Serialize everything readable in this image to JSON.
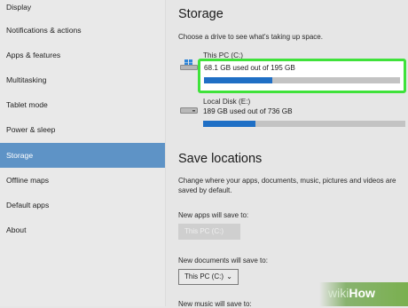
{
  "sidebar": {
    "items": [
      {
        "label": "Display"
      },
      {
        "label": "Notifications & actions"
      },
      {
        "label": "Apps & features"
      },
      {
        "label": "Multitasking"
      },
      {
        "label": "Tablet mode"
      },
      {
        "label": "Power & sleep"
      },
      {
        "label": "Storage"
      },
      {
        "label": "Offline maps"
      },
      {
        "label": "Default apps"
      },
      {
        "label": "About"
      }
    ],
    "active_item": "Storage"
  },
  "storage": {
    "title": "Storage",
    "subtitle": "Choose a drive to see what's taking up space.",
    "drives": [
      {
        "name": "This PC (C:)",
        "usage": "68.1 GB used out of 195 GB",
        "used_fraction": 0.35,
        "icon": "windows-drive-icon"
      },
      {
        "name": "Local Disk (E:)",
        "usage": "189 GB used out of 736 GB",
        "used_fraction": 0.257,
        "icon": "disk-drive-icon"
      }
    ]
  },
  "save_locations": {
    "title": "Save locations",
    "description": "Change where your apps, documents, music, pictures and videos are saved by default.",
    "new_apps_label": "New apps will save to:",
    "new_apps_value": "This PC (C:)",
    "new_documents_label": "New documents will save to:",
    "new_documents_value": "This PC (C:)",
    "new_music_label": "New music will save to:"
  },
  "watermark": {
    "wiki": "wiki",
    "how": "How"
  },
  "colors": {
    "accent": "#1f6fc5",
    "active_nav": "#5e93c6",
    "highlight": "#3fe23a"
  }
}
